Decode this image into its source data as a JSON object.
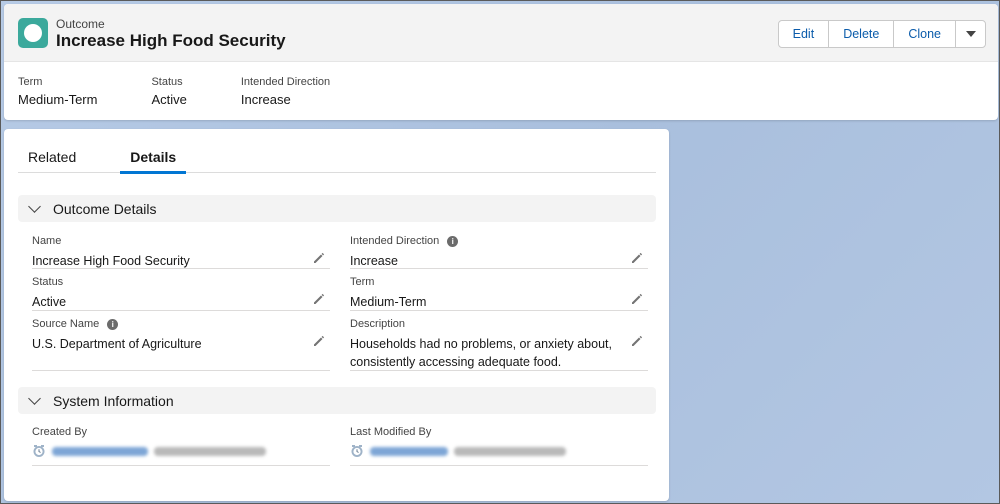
{
  "header": {
    "object_type": "Outcome",
    "record_title": "Increase High Food Security",
    "actions": {
      "edit": "Edit",
      "delete": "Delete",
      "clone": "Clone"
    },
    "highlights": [
      {
        "label": "Term",
        "value": "Medium-Term"
      },
      {
        "label": "Status",
        "value": "Active"
      },
      {
        "label": "Intended Direction",
        "value": "Increase"
      }
    ]
  },
  "tabs": [
    {
      "label": "Related",
      "active": false
    },
    {
      "label": "Details",
      "active": true
    }
  ],
  "outcome_details": {
    "title": "Outcome Details",
    "fields": {
      "name": {
        "label": "Name",
        "value": "Increase High Food Security"
      },
      "intended_direction": {
        "label": "Intended Direction",
        "value": "Increase"
      },
      "status": {
        "label": "Status",
        "value": "Active"
      },
      "term": {
        "label": "Term",
        "value": "Medium-Term"
      },
      "source_name": {
        "label": "Source Name",
        "value": "U.S. Department of Agriculture"
      },
      "description": {
        "label": "Description",
        "value": "Households had no problems, or anxiety about, consistently accessing adequate food."
      }
    }
  },
  "system_information": {
    "title": "System Information",
    "created_by": {
      "label": "Created By"
    },
    "last_modified_by": {
      "label": "Last Modified By"
    }
  },
  "colors": {
    "accent": "#0176d3",
    "brand_icon": "#3ba99c",
    "link": "#0b5cab"
  },
  "icons": {
    "object": "outcome-icon",
    "edit": "pencil-icon",
    "info": "info-icon",
    "user": "user-icon",
    "expand": "chevron-down-icon",
    "more": "caret-down-icon"
  }
}
